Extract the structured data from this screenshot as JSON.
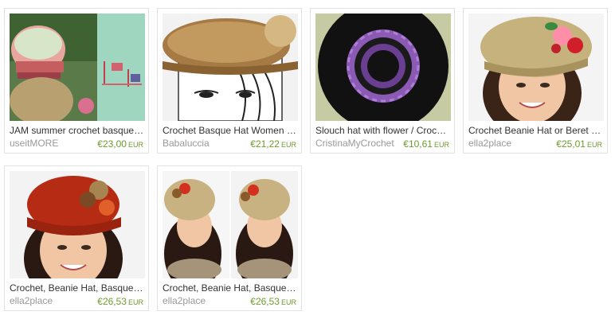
{
  "listings": [
    {
      "title": "JAM summer crochet basque beret",
      "shop": "useitMORE",
      "price": "€23,00",
      "currency": "EUR"
    },
    {
      "title": "Crochet Basque Hat Women Winter",
      "shop": "Babaluccia",
      "price": "€21,22",
      "currency": "EUR"
    },
    {
      "title": "Slouch hat with flower / Crochet beret",
      "shop": "CristinaMyCrochet",
      "price": "€10,61",
      "currency": "EUR"
    },
    {
      "title": "Crochet Beanie Hat or Beret with flowers",
      "shop": "ella2place",
      "price": "€25,01",
      "currency": "EUR"
    },
    {
      "title": "Crochet, Beanie Hat, Basque Beret",
      "shop": "ella2place",
      "price": "€26,53",
      "currency": "EUR"
    },
    {
      "title": "Crochet, Beanie Hat, Basque Beret",
      "shop": "ella2place",
      "price": "€26,53",
      "currency": "EUR"
    }
  ],
  "colors": {
    "price": "#6e9b2c",
    "border": "#e1e1e1",
    "title": "#333333",
    "shop": "#999999"
  }
}
